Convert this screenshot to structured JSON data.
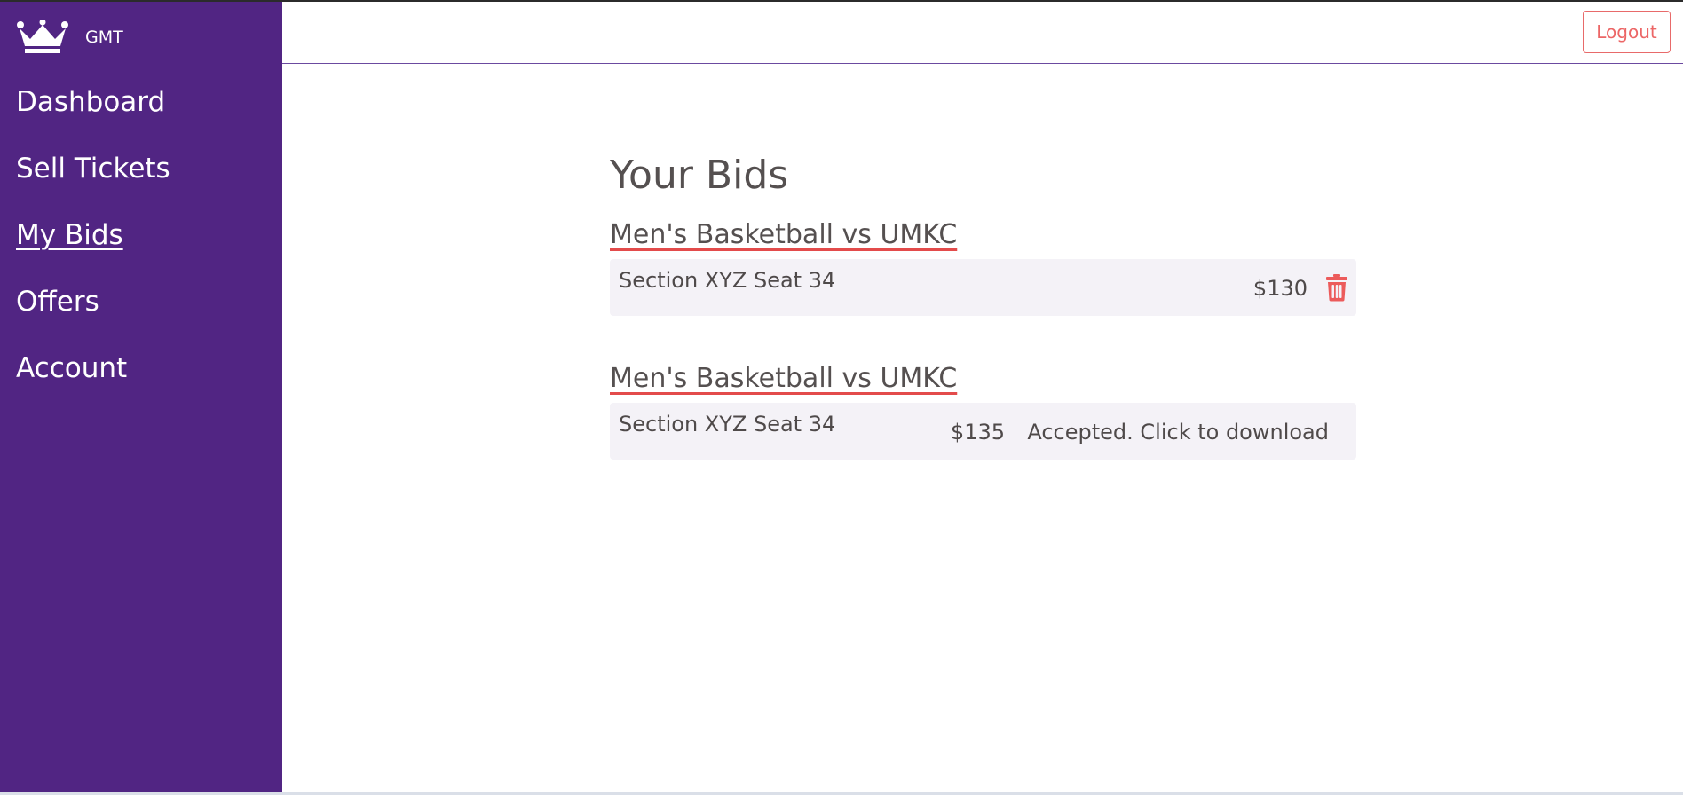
{
  "brand": {
    "name": "GMT",
    "logo_icon": "crown-icon"
  },
  "nav": {
    "items": [
      {
        "label": "Dashboard"
      },
      {
        "label": "Sell Tickets"
      },
      {
        "label": "My Bids",
        "active": true
      },
      {
        "label": "Offers"
      },
      {
        "label": "Account"
      }
    ]
  },
  "header": {
    "logout_label": "Logout"
  },
  "main": {
    "title": "Your Bids",
    "bids": [
      {
        "event": "Men's Basketball vs UMKC",
        "seat": "Section XYZ Seat 34",
        "amount": "$130",
        "action_icon": "trash-icon"
      },
      {
        "event": "Men's Basketball vs UMKC",
        "seat": "Section XYZ Seat 34",
        "amount": "$135",
        "status": "Accepted. Click to download"
      }
    ]
  },
  "colors": {
    "sidebar": "#512583",
    "accent_red": "#ec6666",
    "row_bg": "#f4f2f7",
    "text": "#555050"
  }
}
